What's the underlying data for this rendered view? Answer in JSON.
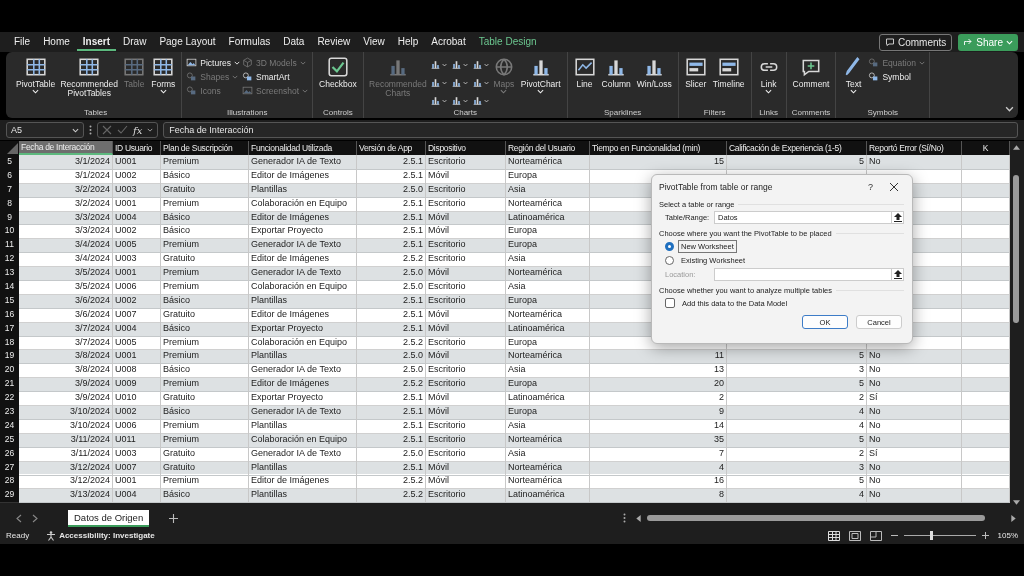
{
  "menu": {
    "tabs": [
      {
        "label": "File",
        "selected": false
      },
      {
        "label": "Home",
        "selected": false
      },
      {
        "label": "Insert",
        "selected": true
      },
      {
        "label": "Draw",
        "selected": false
      },
      {
        "label": "Page Layout",
        "selected": false
      },
      {
        "label": "Formulas",
        "selected": false
      },
      {
        "label": "Data",
        "selected": false
      },
      {
        "label": "Review",
        "selected": false
      },
      {
        "label": "View",
        "selected": false
      },
      {
        "label": "Help",
        "selected": false
      },
      {
        "label": "Acrobat",
        "selected": false
      },
      {
        "label": "Table Design",
        "selected": false,
        "contextual": true
      }
    ],
    "comments_button": "Comments",
    "share_button": "Share"
  },
  "ribbon": {
    "groups": [
      {
        "label": "Tables",
        "items": [
          {
            "kind": "large",
            "label": "PivotTable",
            "dropdown": true,
            "disabled": false
          },
          {
            "kind": "large",
            "label": "Recommended PivotTables",
            "dropdown": false,
            "disabled": false
          },
          {
            "kind": "large",
            "label": "Table",
            "dropdown": false,
            "disabled": true
          },
          {
            "kind": "large",
            "label": "Forms",
            "dropdown": true,
            "disabled": false
          }
        ]
      },
      {
        "label": "Illustrations",
        "items": [
          {
            "kind": "small",
            "label": "Pictures",
            "dropdown": true,
            "disabled": false
          },
          {
            "kind": "small",
            "label": "Shapes",
            "dropdown": true,
            "disabled": true
          },
          {
            "kind": "small",
            "label": "Icons",
            "dropdown": false,
            "disabled": true
          },
          {
            "kind": "small",
            "label": "3D Models",
            "dropdown": true,
            "disabled": true
          },
          {
            "kind": "small",
            "label": "SmartArt",
            "dropdown": false,
            "disabled": false
          },
          {
            "kind": "small",
            "label": "Screenshot",
            "dropdown": true,
            "disabled": true
          }
        ]
      },
      {
        "label": "Controls",
        "items": [
          {
            "kind": "large",
            "label": "Checkbox",
            "dropdown": false,
            "disabled": false
          }
        ]
      },
      {
        "label": "Charts",
        "items": [
          {
            "kind": "large",
            "label": "Recommended Charts",
            "dropdown": false,
            "disabled": true
          },
          {
            "kind": "cluster",
            "dropdown": true,
            "disabled": false
          },
          {
            "kind": "large",
            "label": "Maps",
            "dropdown": true,
            "disabled": true
          },
          {
            "kind": "large",
            "label": "PivotChart",
            "dropdown": true,
            "disabled": false
          }
        ]
      },
      {
        "label": "Sparklines",
        "items": [
          {
            "kind": "large",
            "label": "Line",
            "dropdown": false,
            "disabled": false
          },
          {
            "kind": "large",
            "label": "Column",
            "dropdown": false,
            "disabled": false
          },
          {
            "kind": "large",
            "label": "Win/Loss",
            "dropdown": false,
            "disabled": false
          }
        ]
      },
      {
        "label": "Filters",
        "items": [
          {
            "kind": "large",
            "label": "Slicer",
            "dropdown": false,
            "disabled": false
          },
          {
            "kind": "large",
            "label": "Timeline",
            "dropdown": false,
            "disabled": false
          }
        ]
      },
      {
        "label": "Links",
        "items": [
          {
            "kind": "large",
            "label": "Link",
            "dropdown": true,
            "disabled": false
          }
        ]
      },
      {
        "label": "Comments",
        "items": [
          {
            "kind": "large",
            "label": "Comment",
            "dropdown": false,
            "disabled": false
          }
        ]
      },
      {
        "label": "Symbols",
        "items": [
          {
            "kind": "large",
            "label": "Text",
            "dropdown": true,
            "disabled": false
          },
          {
            "kind": "small",
            "label": "Equation",
            "dropdown": true,
            "disabled": true
          },
          {
            "kind": "small",
            "label": "Symbol",
            "dropdown": false,
            "disabled": false
          }
        ]
      }
    ]
  },
  "formula_bar": {
    "name_box": "A5",
    "function_button": "fx",
    "formula": "Fecha de Interacción"
  },
  "table": {
    "columns": [
      {
        "label": "Fecha de Interacción",
        "selected": true
      },
      {
        "label": "ID Usuario",
        "selected": false
      },
      {
        "label": "Plan de Suscripción",
        "selected": false
      },
      {
        "label": "Funcionalidad Utilizada",
        "selected": false
      },
      {
        "label": "Versión de App",
        "selected": false
      },
      {
        "label": "Dispositivo",
        "selected": false
      },
      {
        "label": "Región del Usuario",
        "selected": false
      },
      {
        "label": "Tiempo en Funcionalidad (min)",
        "selected": false
      },
      {
        "label": "Calificación de Experiencia (1-5)",
        "selected": false
      },
      {
        "label": "Reportó Error (Sí/No)",
        "selected": false
      },
      {
        "label": "K",
        "selected": false
      }
    ],
    "rows": [
      {
        "number": "5",
        "cells": [
          "3/1/2024",
          "U001",
          "Premium",
          "Generador IA de Texto",
          "2.5.1",
          "Escritorio",
          "Norteamérica",
          "15",
          "5",
          "No"
        ]
      },
      {
        "number": "6",
        "cells": [
          "3/1/2024",
          "U002",
          "Básico",
          "Editor de Imágenes",
          "2.5.1",
          "Móvil",
          "Europa"
        ]
      },
      {
        "number": "7",
        "cells": [
          "3/2/2024",
          "U003",
          "Gratuito",
          "Plantillas",
          "2.5.0",
          "Escritorio",
          "Asia"
        ]
      },
      {
        "number": "8",
        "cells": [
          "3/2/2024",
          "U001",
          "Premium",
          "Colaboración en Equipo",
          "2.5.1",
          "Escritorio",
          "Norteamérica"
        ]
      },
      {
        "number": "9",
        "cells": [
          "3/3/2024",
          "U004",
          "Básico",
          "Editor de Imágenes",
          "2.5.1",
          "Móvil",
          "Latinoamérica"
        ]
      },
      {
        "number": "10",
        "cells": [
          "3/3/2024",
          "U002",
          "Básico",
          "Exportar Proyecto",
          "2.5.1",
          "Móvil",
          "Europa"
        ]
      },
      {
        "number": "11",
        "cells": [
          "3/4/2024",
          "U005",
          "Premium",
          "Generador IA de Texto",
          "2.5.1",
          "Escritorio",
          "Europa"
        ]
      },
      {
        "number": "12",
        "cells": [
          "3/4/2024",
          "U003",
          "Gratuito",
          "Editor de Imágenes",
          "2.5.2",
          "Escritorio",
          "Asia"
        ]
      },
      {
        "number": "13",
        "cells": [
          "3/5/2024",
          "U001",
          "Premium",
          "Generador IA de Texto",
          "2.5.0",
          "Móvil",
          "Norteamérica"
        ]
      },
      {
        "number": "14",
        "cells": [
          "3/5/2024",
          "U006",
          "Premium",
          "Colaboración en Equipo",
          "2.5.0",
          "Escritorio",
          "Asia"
        ]
      },
      {
        "number": "15",
        "cells": [
          "3/6/2024",
          "U002",
          "Básico",
          "Plantillas",
          "2.5.1",
          "Escritorio",
          "Europa"
        ]
      },
      {
        "number": "16",
        "cells": [
          "3/6/2024",
          "U007",
          "Gratuito",
          "Editor de Imágenes",
          "2.5.1",
          "Móvil",
          "Norteamérica"
        ]
      },
      {
        "number": "17",
        "cells": [
          "3/7/2024",
          "U004",
          "Básico",
          "Exportar Proyecto",
          "2.5.1",
          "Móvil",
          "Latinoamérica"
        ]
      },
      {
        "number": "18",
        "cells": [
          "3/7/2024",
          "U005",
          "Premium",
          "Colaboración en Equipo",
          "2.5.2",
          "Escritorio",
          "Europa"
        ]
      },
      {
        "number": "19",
        "cells": [
          "3/8/2024",
          "U001",
          "Premium",
          "Plantillas",
          "2.5.0",
          "Móvil",
          "Norteamérica",
          "11",
          "5",
          "No"
        ]
      },
      {
        "number": "20",
        "cells": [
          "3/8/2024",
          "U008",
          "Básico",
          "Generador IA de Texto",
          "2.5.0",
          "Escritorio",
          "Asia",
          "13",
          "3",
          "No"
        ]
      },
      {
        "number": "21",
        "cells": [
          "3/9/2024",
          "U009",
          "Premium",
          "Editor de Imágenes",
          "2.5.2",
          "Escritorio",
          "Europa",
          "20",
          "5",
          "No"
        ]
      },
      {
        "number": "22",
        "cells": [
          "3/9/2024",
          "U010",
          "Gratuito",
          "Exportar Proyecto",
          "2.5.1",
          "Móvil",
          "Latinoamérica",
          "2",
          "2",
          "Sí"
        ]
      },
      {
        "number": "23",
        "cells": [
          "3/10/2024",
          "U002",
          "Básico",
          "Generador IA de Texto",
          "2.5.1",
          "Móvil",
          "Europa",
          "9",
          "4",
          "No"
        ]
      },
      {
        "number": "24",
        "cells": [
          "3/10/2024",
          "U006",
          "Premium",
          "Plantillas",
          "2.5.1",
          "Escritorio",
          "Asia",
          "14",
          "4",
          "No"
        ]
      },
      {
        "number": "25",
        "cells": [
          "3/11/2024",
          "U011",
          "Premium",
          "Colaboración en Equipo",
          "2.5.1",
          "Escritorio",
          "Norteamérica",
          "35",
          "5",
          "No"
        ]
      },
      {
        "number": "26",
        "cells": [
          "3/11/2024",
          "U003",
          "Gratuito",
          "Generador IA de Texto",
          "2.5.0",
          "Escritorio",
          "Asia",
          "7",
          "2",
          "Sí"
        ]
      },
      {
        "number": "27",
        "cells": [
          "3/12/2024",
          "U007",
          "Gratuito",
          "Plantillas",
          "2.5.1",
          "Móvil",
          "Norteamérica",
          "4",
          "3",
          "No"
        ]
      },
      {
        "number": "28",
        "cells": [
          "3/12/2024",
          "U001",
          "Premium",
          "Editor de Imágenes",
          "2.5.2",
          "Móvil",
          "Norteamérica",
          "16",
          "5",
          "No"
        ]
      },
      {
        "number": "29",
        "cells": [
          "3/13/2024",
          "U004",
          "Básico",
          "Plantillas",
          "2.5.2",
          "Escritorio",
          "Latinoamérica",
          "8",
          "4",
          "No"
        ]
      }
    ]
  },
  "dialog": {
    "title": "PivotTable from table or range",
    "help": "?",
    "source_heading": "Select a table or range",
    "range_label": "Table/Range:",
    "range_value": "Datos",
    "place_heading": "Choose where you want the PivotTable to be placed",
    "options": [
      {
        "label": "New Worksheet",
        "selected": true
      },
      {
        "label": "Existing Worksheet",
        "selected": false
      }
    ],
    "location_label": "Location:",
    "location_disabled": true,
    "tables_heading": "Choose whether you want to analyze multiple tables",
    "data_model": {
      "label": "Add this data to the Data Model",
      "checked": false
    },
    "buttons": [
      {
        "label": "OK",
        "default": true
      },
      {
        "label": "Cancel",
        "default": false
      }
    ]
  },
  "sheets": [
    {
      "label": "Datos de Origen",
      "selected": true
    }
  ],
  "status_bar": {
    "ready": "Ready",
    "accessibility": "Accessibility: Investigate",
    "zoom": {
      "level": 0.38,
      "reading": "105%"
    }
  }
}
